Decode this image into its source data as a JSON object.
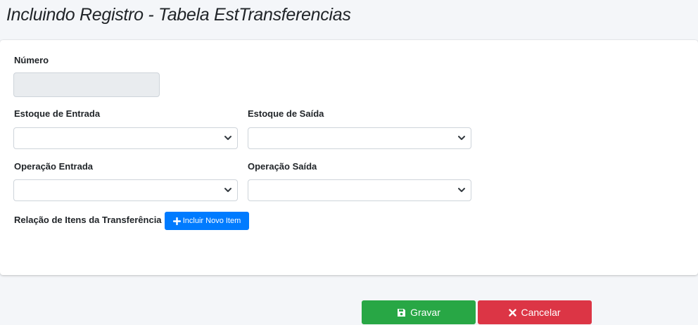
{
  "header": {
    "title": "Incluindo Registro - Tabela EstTransferencias"
  },
  "form": {
    "numero_label": "Número",
    "numero_value": "",
    "estoque_entrada_label": "Estoque de Entrada",
    "estoque_entrada_value": "",
    "estoque_saida_label": "Estoque de Saída",
    "estoque_saida_value": "",
    "operacao_entrada_label": "Operação Entrada",
    "operacao_entrada_value": "",
    "operacao_saida_label": "Operação Saída",
    "operacao_saida_value": "",
    "itens_label": "Relação de Itens da Transferência",
    "add_item_label": "Incluir Novo Item"
  },
  "actions": {
    "save_label": "Gravar",
    "cancel_label": "Cancelar"
  },
  "icons": {
    "add_item": "plus-icon",
    "save": "floppy-disk-icon",
    "cancel": "times-icon",
    "select": "chevron-down-icon"
  },
  "colors": {
    "primary": "#007bff",
    "success": "#28a745",
    "danger": "#dc3545",
    "background": "#f4f6f9"
  }
}
